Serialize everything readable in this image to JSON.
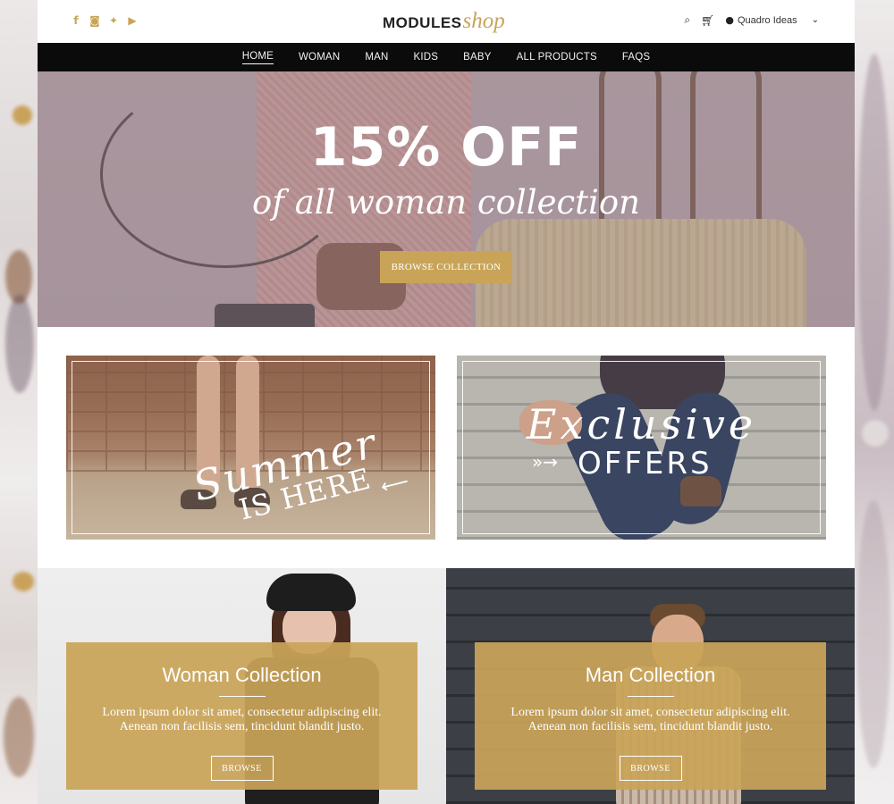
{
  "header": {
    "social_icons": [
      "facebook-icon",
      "instagram-icon",
      "twitter-icon",
      "youtube-icon"
    ],
    "logo_primary": "MODULES",
    "logo_secondary": "shop",
    "user_name": "Quadro Ideas"
  },
  "nav": {
    "items": [
      "HOME",
      "WOMAN",
      "MAN",
      "KIDS",
      "BABY",
      "ALL PRODUCTS",
      "FAQS"
    ],
    "active": "HOME"
  },
  "hero": {
    "title": "15% OFF",
    "subtitle": "of all woman collection",
    "button": "BROWSE COLLECTION"
  },
  "promos": {
    "summer": {
      "script": "Summer",
      "line": "IS HERE"
    },
    "exclusive": {
      "script": "Exclusive",
      "line": "OFFERS"
    }
  },
  "collections": [
    {
      "title": "Woman Collection",
      "line1": "Lorem ipsum dolor sit amet, consectetur adipiscing elit.",
      "line2": "Aenean non facilisis sem, tincidunt blandit justo.",
      "button": "BROWSE"
    },
    {
      "title": "Man Collection",
      "line1": "Lorem ipsum dolor sit amet, consectetur adipiscing elit.",
      "line2": "Aenean non facilisis sem, tincidunt blandit justo.",
      "button": "BROWSE"
    }
  ],
  "colors": {
    "accent": "#c9a458",
    "nav_bg": "#0b0b0b",
    "text_dark": "#222222"
  }
}
